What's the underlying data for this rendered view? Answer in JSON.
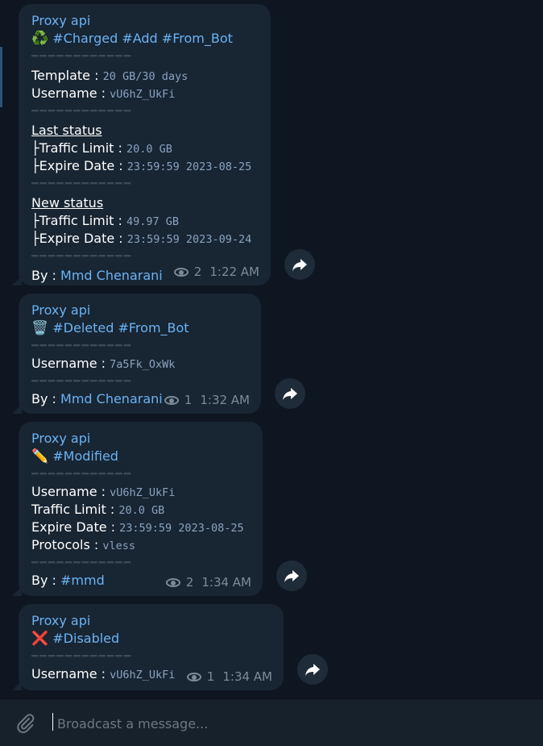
{
  "messages": [
    {
      "sender": "Proxy api",
      "title_emoji": "♻️",
      "tags": "#Charged #Add #From_Bot",
      "separator": "━━━━━━━━━━━━",
      "template_label": "Template :",
      "template_value": "20 GB/30 days",
      "username_label": "Username :",
      "username_value": "vU6hZ_UkFi",
      "last_status_label": "Last status",
      "last_traffic_label": "├Traffic Limit :",
      "last_traffic_value": "20.0 GB",
      "last_expire_label": "├Expire Date :",
      "last_expire_value": "23:59:59 2023-08-25",
      "new_status_label": "New status",
      "new_traffic_label": "├Traffic Limit :",
      "new_traffic_value": "49.97 GB",
      "new_expire_label": "├Expire Date :",
      "new_expire_value": "23:59:59 2023-09-24",
      "by_label": "By :",
      "by_value": "Mmd Chenarani",
      "views": "2",
      "time": "1:22 AM"
    },
    {
      "sender": "Proxy api",
      "title_emoji": "🗑️",
      "tags": "#Deleted #From_Bot",
      "separator": "━━━━━━━━━━━━",
      "username_label": "Username :",
      "username_value": "7a5Fk_OxWk",
      "by_label": "By :",
      "by_value": "Mmd Chenarani",
      "views": "1",
      "time": "1:32 AM"
    },
    {
      "sender": "Proxy api",
      "title_emoji": "✏️",
      "tags": "#Modified",
      "separator": "━━━━━━━━━━━━",
      "username_label": "Username :",
      "username_value": "vU6hZ_UkFi",
      "traffic_label": "Traffic Limit :",
      "traffic_value": "20.0 GB",
      "expire_label": "Expire Date :",
      "expire_value": "23:59:59 2023-08-25",
      "protocols_label": "Protocols :",
      "protocols_value": "vless",
      "by_label": "By :",
      "by_value": "#mmd",
      "views": "2",
      "time": "1:34 AM"
    },
    {
      "sender": "Proxy api",
      "title_emoji": "❌",
      "tags": "#Disabled",
      "separator": "━━━━━━━━━━━━",
      "username_label": "Username :",
      "username_value": "vU6hZ_UkFi",
      "views": "1",
      "time": "1:34 AM"
    }
  ],
  "composer": {
    "placeholder": "Broadcast a message...",
    "attach_icon": "paperclip-icon"
  },
  "icons": {
    "views": "eye-icon",
    "forward": "forward-arrow-icon"
  },
  "colors": {
    "background": "#0e1621",
    "bubble": "#182533",
    "accent": "#6ab3f3",
    "mono_text": "#8aa3bf",
    "meta_text": "#7c8b99"
  }
}
